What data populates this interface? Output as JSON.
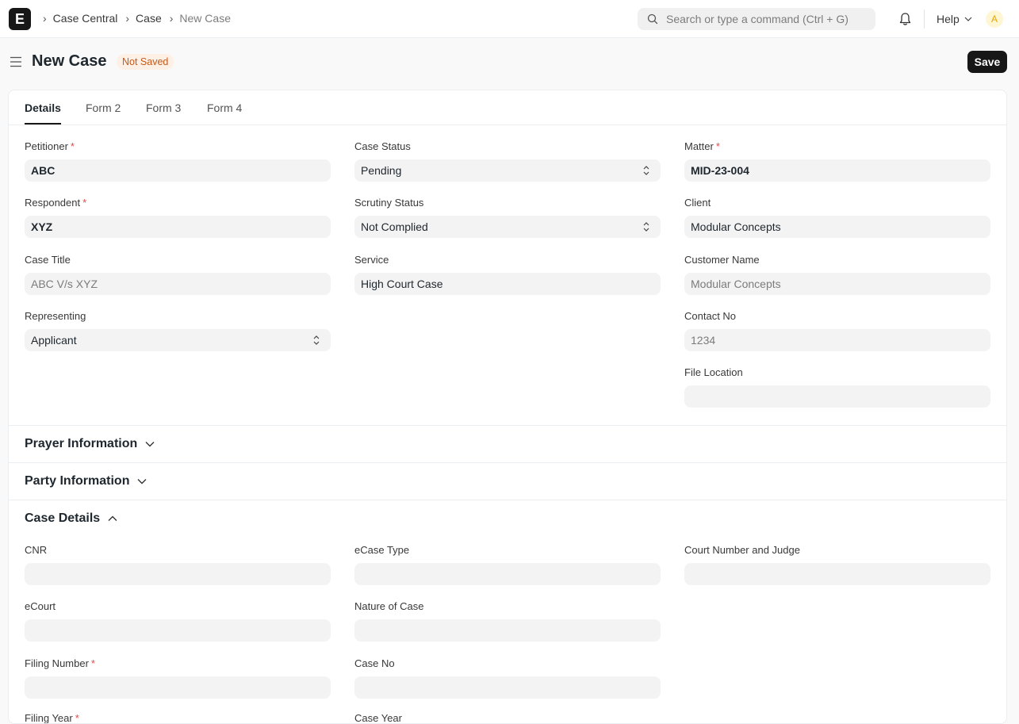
{
  "navbar": {
    "logo_letter": "E",
    "breadcrumbs": [
      "Case Central",
      "Case",
      "New Case"
    ],
    "search_placeholder": "Search or type a command (Ctrl + G)",
    "help_label": "Help",
    "avatar_initial": "A"
  },
  "page": {
    "title": "New Case",
    "status_badge": "Not Saved",
    "save_label": "Save"
  },
  "tabs": [
    "Details",
    "Form 2",
    "Form 3",
    "Form 4"
  ],
  "details": {
    "petitioner": {
      "label": "Petitioner",
      "value": "ABC"
    },
    "respondent": {
      "label": "Respondent",
      "value": "XYZ"
    },
    "case_title": {
      "label": "Case Title",
      "value": "ABC V/s XYZ"
    },
    "representing": {
      "label": "Representing",
      "value": "Applicant"
    },
    "case_status": {
      "label": "Case Status",
      "value": "Pending"
    },
    "scrutiny_status": {
      "label": "Scrutiny Status",
      "value": "Not Complied"
    },
    "service": {
      "label": "Service",
      "value": "High Court Case"
    },
    "matter": {
      "label": "Matter",
      "value": "MID-23-004"
    },
    "client": {
      "label": "Client",
      "value": "Modular Concepts"
    },
    "customer_name": {
      "label": "Customer Name",
      "value": "Modular Concepts"
    },
    "contact_no": {
      "label": "Contact No",
      "value": "1234"
    },
    "file_location": {
      "label": "File Location",
      "value": ""
    }
  },
  "sections": {
    "prayer": "Prayer Information",
    "party": "Party Information",
    "case_details": "Case Details"
  },
  "case_details": {
    "cnr": {
      "label": "CNR",
      "value": ""
    },
    "ecase_type": {
      "label": "eCase Type",
      "value": ""
    },
    "court_number": {
      "label": "Court Number and Judge",
      "value": ""
    },
    "ecourt": {
      "label": "eCourt",
      "value": ""
    },
    "nature_of_case": {
      "label": "Nature of Case",
      "value": ""
    },
    "filing_number": {
      "label": "Filing Number",
      "value": ""
    },
    "case_no": {
      "label": "Case No",
      "value": ""
    },
    "filing_year": {
      "label": "Filing Year",
      "value": ""
    },
    "case_year": {
      "label": "Case Year",
      "value": ""
    }
  }
}
